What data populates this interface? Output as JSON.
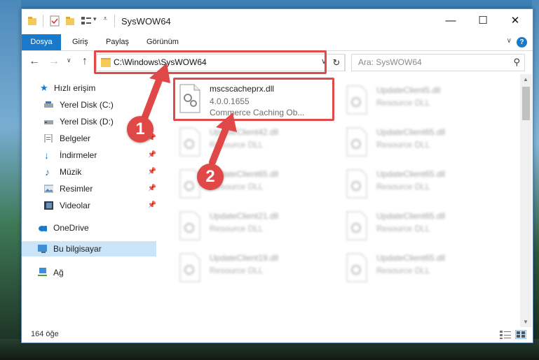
{
  "window": {
    "title": "SysWOW64",
    "controls": {
      "minimize": "—",
      "maximize": "☐",
      "close": "✕"
    }
  },
  "ribbon": {
    "tabs": [
      {
        "label": "Dosya",
        "active": true
      },
      {
        "label": "Giriş"
      },
      {
        "label": "Paylaş"
      },
      {
        "label": "Görünüm"
      }
    ],
    "help": "?"
  },
  "nav": {
    "address": "C:\\Windows\\SysWOW64",
    "search_placeholder": "Ara: SysWOW64"
  },
  "sidebar": {
    "items": [
      {
        "label": "Hızlı erişim",
        "icon": "star-icon"
      },
      {
        "label": "Yerel Disk (C:)",
        "icon": "drive-icon"
      },
      {
        "label": "Yerel Disk (D:)",
        "icon": "drive-icon"
      },
      {
        "label": "Belgeler",
        "icon": "documents-icon",
        "pinned": true
      },
      {
        "label": "İndirmeler",
        "icon": "download-icon",
        "pinned": true
      },
      {
        "label": "Müzik",
        "icon": "music-icon",
        "pinned": true
      },
      {
        "label": "Resimler",
        "icon": "pictures-icon",
        "pinned": true
      },
      {
        "label": "Videolar",
        "icon": "videos-icon",
        "pinned": true
      },
      {
        "label": "OneDrive",
        "icon": "cloud-icon"
      },
      {
        "label": "Bu bilgisayar",
        "icon": "computer-icon",
        "selected": true
      },
      {
        "label": "Ağ",
        "icon": "network-icon"
      }
    ]
  },
  "files": {
    "highlighted": {
      "name": "mscscacheprx.dll",
      "version": "4.0.0.1655",
      "description": "Commerce Caching Ob..."
    },
    "left_column": [
      {
        "name": "UpdateClient42.dll",
        "type": "Resource DLL"
      },
      {
        "name": "UpdateClient65.dll",
        "type": "Resource DLL"
      },
      {
        "name": "UpdateClient21.dll",
        "type": "Resource DLL"
      },
      {
        "name": "UpdateClient19.dll",
        "type": "Resource DLL"
      }
    ],
    "right_column": [
      {
        "name": "UpdateClient5.dll",
        "type": "Resource DLL"
      },
      {
        "name": "UpdateClient65.dll",
        "type": "Resource DLL"
      },
      {
        "name": "UpdateClient65.dll",
        "type": "Resource DLL"
      },
      {
        "name": "UpdateClient65.dll",
        "type": "Resource DLL"
      },
      {
        "name": "UpdateClient65.dll",
        "type": "Resource DLL"
      }
    ]
  },
  "status": {
    "count": "164 öğe"
  },
  "annotations": {
    "step1": "1",
    "step2": "2",
    "color": "#e04848"
  }
}
